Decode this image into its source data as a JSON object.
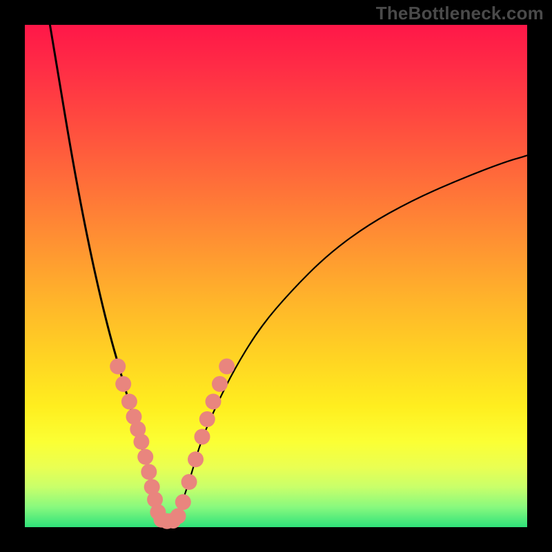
{
  "watermark": "TheBottleneck.com",
  "chart_data": {
    "type": "line",
    "title": "",
    "xlabel": "",
    "ylabel": "",
    "xlim": [
      0,
      100
    ],
    "ylim": [
      0,
      100
    ],
    "series": [
      {
        "name": "left-curve",
        "x": [
          5,
          7,
          9,
          11,
          13,
          15,
          17,
          19,
          21,
          23,
          24.5,
          25.5,
          26.3,
          27
        ],
        "y": [
          100,
          88,
          76,
          65,
          55,
          46,
          38,
          31,
          24,
          17,
          12,
          8,
          4,
          1.5
        ]
      },
      {
        "name": "right-curve",
        "x": [
          30,
          31,
          33,
          35,
          38,
          42,
          47,
          53,
          60,
          68,
          77,
          86,
          95,
          100
        ],
        "y": [
          1.5,
          4,
          10,
          17,
          24,
          32,
          40,
          47,
          54,
          60,
          65,
          69,
          72.5,
          74
        ]
      }
    ],
    "scatter": [
      {
        "name": "left-dot-cluster",
        "points": [
          {
            "x": 18.5,
            "y": 32
          },
          {
            "x": 19.6,
            "y": 28.5
          },
          {
            "x": 20.8,
            "y": 25
          },
          {
            "x": 21.7,
            "y": 22
          },
          {
            "x": 22.5,
            "y": 19.5
          },
          {
            "x": 23.2,
            "y": 17
          },
          {
            "x": 24.0,
            "y": 14
          },
          {
            "x": 24.7,
            "y": 11
          },
          {
            "x": 25.3,
            "y": 8
          },
          {
            "x": 25.9,
            "y": 5.5
          },
          {
            "x": 26.5,
            "y": 3
          },
          {
            "x": 27.2,
            "y": 1.5
          },
          {
            "x": 28.3,
            "y": 1.2
          },
          {
            "x": 29.5,
            "y": 1.3
          }
        ]
      },
      {
        "name": "right-dot-cluster",
        "points": [
          {
            "x": 30.5,
            "y": 2.2
          },
          {
            "x": 31.5,
            "y": 5
          },
          {
            "x": 32.7,
            "y": 9
          },
          {
            "x": 34.0,
            "y": 13.5
          },
          {
            "x": 35.3,
            "y": 18
          },
          {
            "x": 36.3,
            "y": 21.5
          },
          {
            "x": 37.5,
            "y": 25
          },
          {
            "x": 38.8,
            "y": 28.5
          },
          {
            "x": 40.2,
            "y": 32
          }
        ]
      }
    ],
    "colors": {
      "curve": "#000000",
      "dots": "#e9857e",
      "background_top": "#ff1a49",
      "background_bottom": "#2fe27a"
    }
  }
}
